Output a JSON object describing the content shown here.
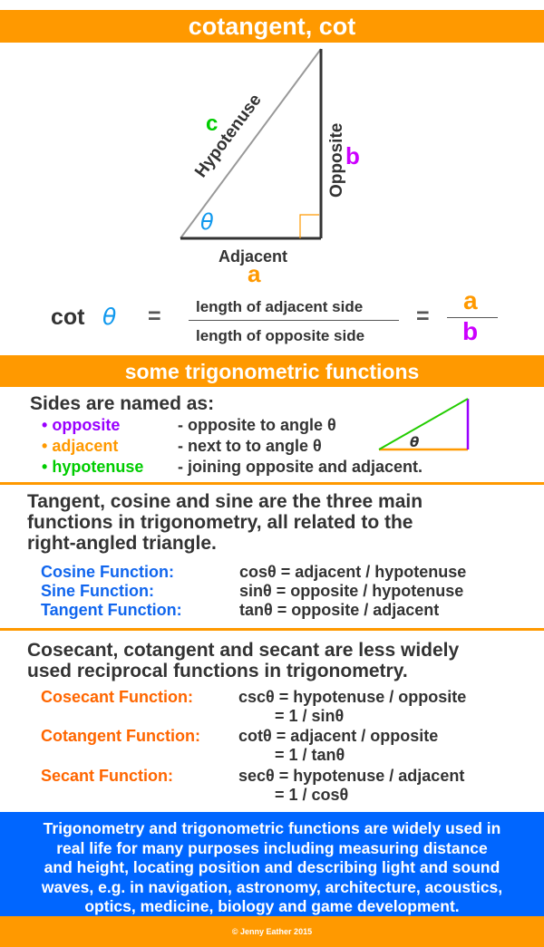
{
  "title": "cotangent, cot",
  "colors": {
    "banner": "#ff9900",
    "info_box": "#0066ff",
    "opposite": "#cc00ff",
    "adjacent": "#ff9900",
    "hypotenuse": "#00cc00",
    "theta": "#1199ee",
    "function_label_blue": "#1166ee",
    "function_label_orange": "#ff6600"
  },
  "diagram": {
    "hypotenuse_label": "Hypotenuse",
    "hypotenuse_letter": "c",
    "opposite_label": "Opposite",
    "opposite_letter": "b",
    "adjacent_label": "Adjacent",
    "adjacent_letter": "a",
    "angle_symbol": "θ"
  },
  "formula": {
    "lhs_fn": "cot",
    "lhs_theta": "θ",
    "equals": "=",
    "numerator_text": "length of adjacent side",
    "denominator_text": "length of opposite side",
    "equals2": "=",
    "numerator_letter": "a",
    "denominator_letter": "b"
  },
  "section_title": "some trigonometric functions",
  "sides": {
    "heading": "Sides are named as:",
    "items": [
      {
        "bullet": "•",
        "name": "opposite",
        "desc": "- opposite to angle θ"
      },
      {
        "bullet": "•",
        "name": "adjacent",
        "desc": "- next to to angle θ"
      },
      {
        "bullet": "•",
        "name": "hypotenuse",
        "desc": "- joining opposite and adjacent."
      }
    ],
    "mini_angle": "θ"
  },
  "main_functions": {
    "intro_lines": [
      "Tangent, cosine and sine are the three main",
      "functions in trigonometry, all related to the",
      "right-angled triangle."
    ],
    "rows": [
      {
        "label": "Cosine Function:",
        "formula": "cosθ = adjacent / hypotenuse"
      },
      {
        "label": "Sine Function:",
        "formula": "sinθ  = opposite / hypotenuse"
      },
      {
        "label": "Tangent Function:",
        "formula": "tanθ  = opposite / adjacent"
      }
    ]
  },
  "reciprocal_functions": {
    "intro_lines": [
      "Cosecant, cotangent and secant are less widely",
      "used reciprocal functions in trigonometry."
    ],
    "rows": [
      {
        "label": "Cosecant Function:",
        "formula": "cscθ = hypotenuse / opposite",
        "alt": "= 1 / sinθ"
      },
      {
        "label": "Cotangent Function:",
        "formula": "cotθ = adjacent / opposite",
        "alt": "= 1 / tanθ"
      },
      {
        "label": "Secant Function:",
        "formula": "secθ = hypotenuse / adjacent",
        "alt": "= 1 / cosθ"
      }
    ]
  },
  "info_lines": [
    "Trigonometry and trigonometric functions are widely used in",
    "real life for many purposes including measuring distance",
    "and height, locating position and describing light and sound",
    "waves, e.g. in navigation, astronomy, architecture, acoustics,",
    "optics, medicine, biology and game development."
  ],
  "footer": "© Jenny Eather 2015"
}
